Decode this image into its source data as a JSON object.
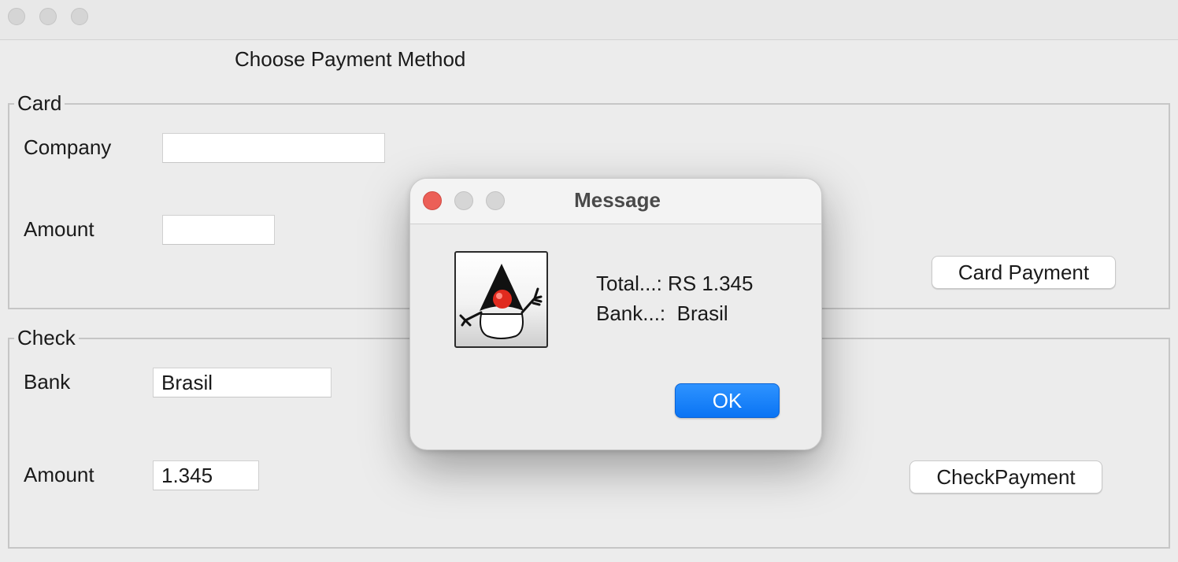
{
  "window": {
    "heading": "Choose Payment Method"
  },
  "card_group": {
    "title": "Card",
    "company_label": "Company",
    "company_value": "",
    "amount_label": "Amount",
    "amount_value": "",
    "button_label": "Card Payment"
  },
  "check_group": {
    "title": "Check",
    "bank_label": "Bank",
    "bank_value": "Brasil",
    "amount_label": "Amount",
    "amount_value": "1.345",
    "button_label": "CheckPayment"
  },
  "dialog": {
    "title": "Message",
    "line1": "Total...: RS 1.345",
    "line2": "Bank...:  Brasil",
    "ok_label": "OK",
    "icon": "java-duke-icon"
  },
  "colors": {
    "close_red": "#ec5f57",
    "ok_blue": "#0a74f4"
  }
}
